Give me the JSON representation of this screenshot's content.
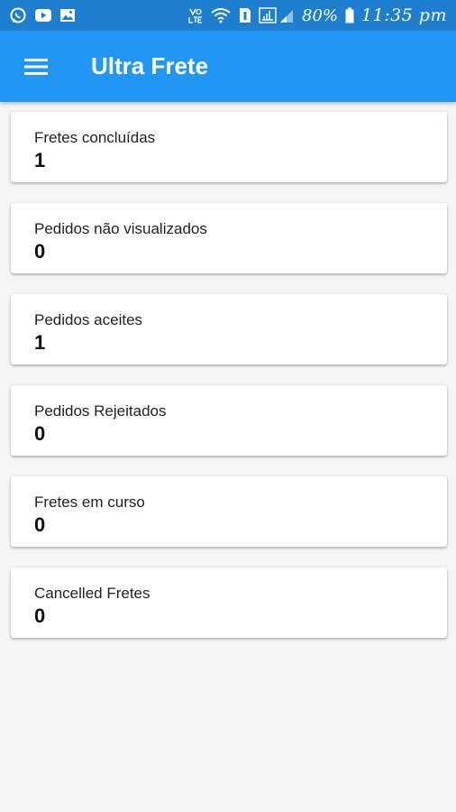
{
  "status_bar": {
    "battery": "80%",
    "time": "11:35 pm",
    "icons": [
      "whatsapp-icon",
      "youtube-icon",
      "gallery-icon",
      "volte-icon",
      "wifi-icon",
      "sim-icon",
      "signal-icon",
      "battery-icon"
    ]
  },
  "app_bar": {
    "title": "Ultra Frete",
    "menu_icon": "hamburger-menu-icon",
    "color": "#2196f3"
  },
  "cards": [
    {
      "label": "Fretes concluídas",
      "value": "1"
    },
    {
      "label": "Pedidos não visualizados",
      "value": "0"
    },
    {
      "label": "Pedidos aceites",
      "value": "1"
    },
    {
      "label": "Pedidos Rejeitados",
      "value": "0"
    },
    {
      "label": "Fretes em curso",
      "value": "0"
    },
    {
      "label": "Cancelled Fretes",
      "value": "0"
    }
  ]
}
